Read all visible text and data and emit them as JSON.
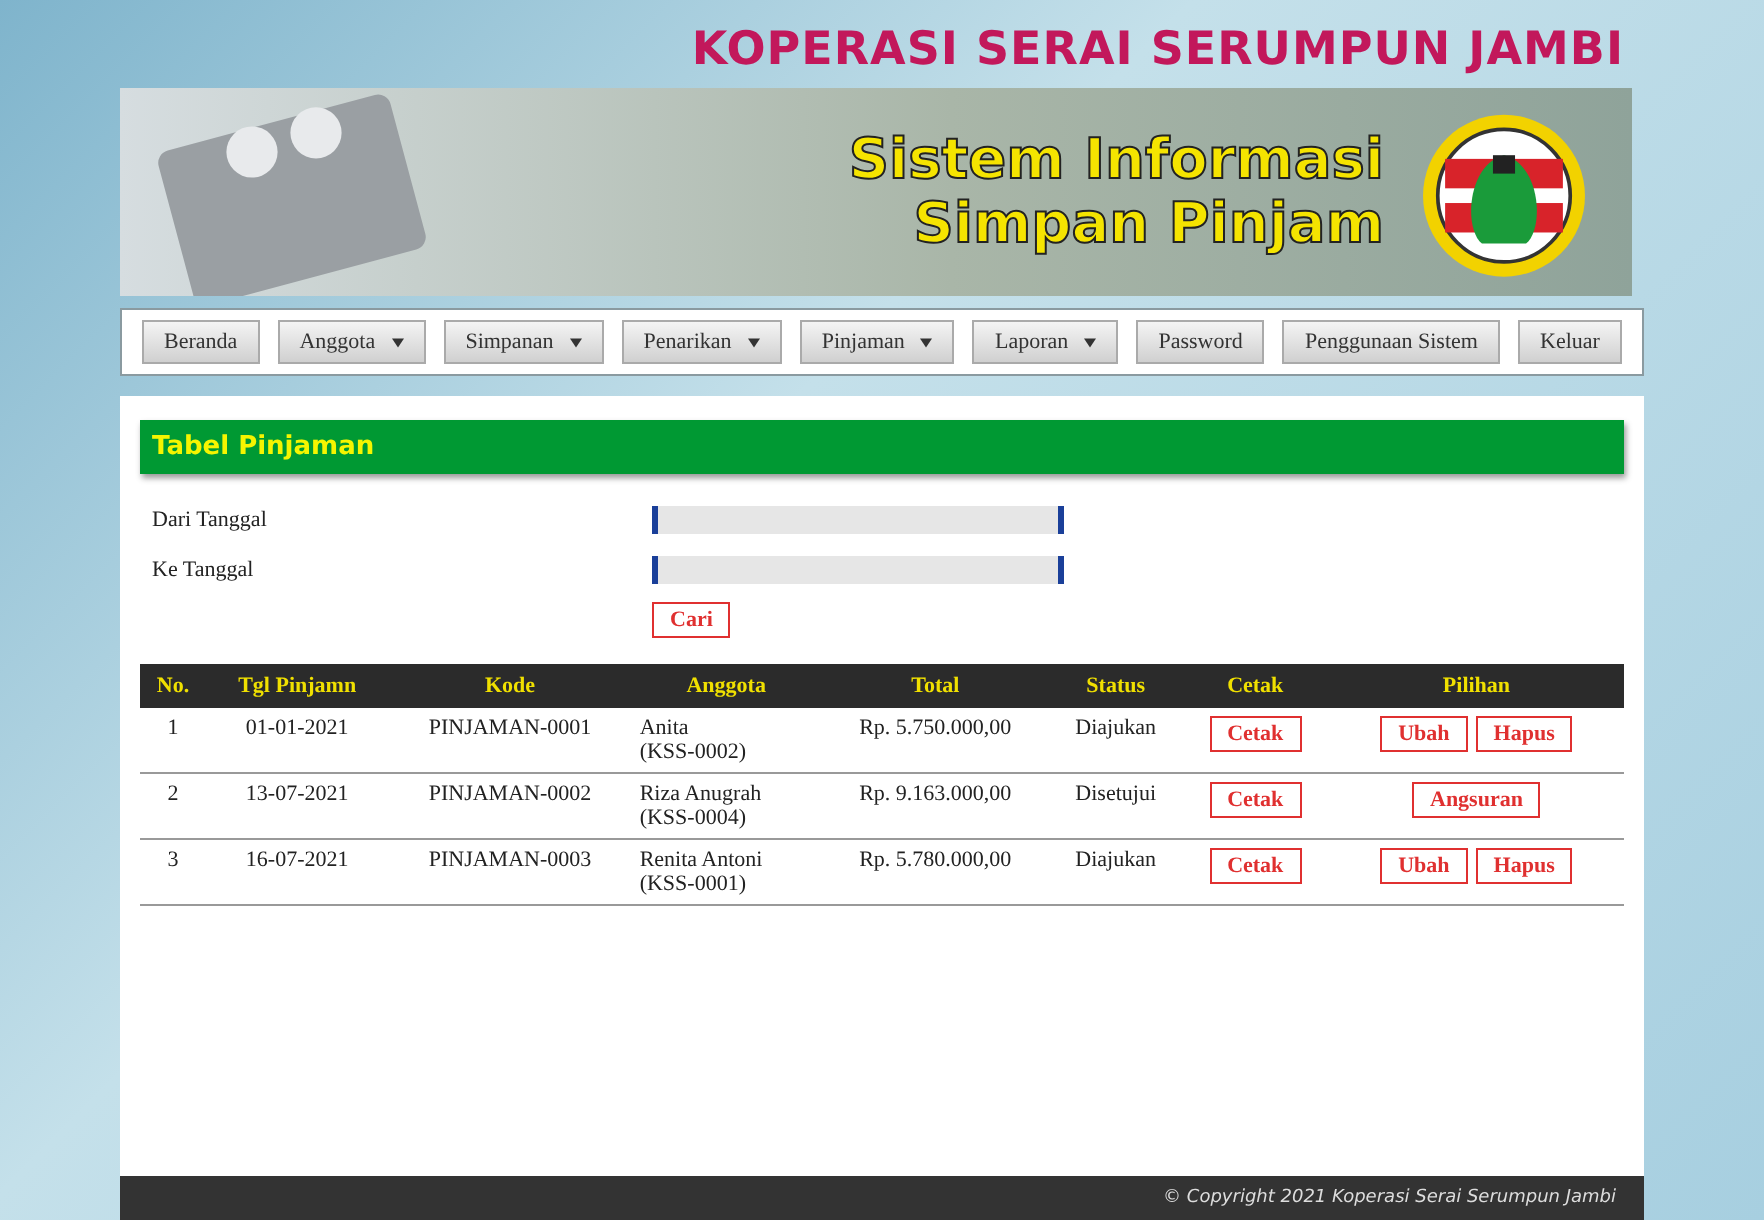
{
  "header": {
    "org_title": "KOPERASI SERAI SERUMPUN JAMBI",
    "app_title_line1": "Sistem Informasi",
    "app_title_line2": "Simpan Pinjam"
  },
  "nav": [
    {
      "label": "Beranda",
      "dropdown": false
    },
    {
      "label": "Anggota",
      "dropdown": true
    },
    {
      "label": "Simpanan",
      "dropdown": true
    },
    {
      "label": "Penarikan",
      "dropdown": true
    },
    {
      "label": "Pinjaman",
      "dropdown": true
    },
    {
      "label": "Laporan",
      "dropdown": true
    },
    {
      "label": "Password",
      "dropdown": false
    },
    {
      "label": "Penggunaan Sistem",
      "dropdown": false
    },
    {
      "label": "Keluar",
      "dropdown": false
    }
  ],
  "panel_title": "Tabel Pinjaman",
  "filters": [
    {
      "label": "Dari Tanggal"
    },
    {
      "label": "Ke Tanggal"
    }
  ],
  "search_button": "Cari",
  "table": {
    "columns": [
      "No.",
      "Tgl Pinjamn",
      "Kode",
      "Anggota",
      "Total",
      "Status",
      "Cetak",
      "Pilihan"
    ],
    "rows": [
      {
        "no": "1",
        "date": "01-01-2021",
        "code": "PINJAMAN-0001",
        "member": "Anita",
        "member_id": "(KSS-0002)",
        "total": "Rp. 5.750.000,00",
        "status": "Diajukan",
        "print": "Cetak",
        "actions": [
          "Ubah",
          "Hapus"
        ]
      },
      {
        "no": "2",
        "date": "13-07-2021",
        "code": "PINJAMAN-0002",
        "member": "Riza Anugrah",
        "member_id": "(KSS-0004)",
        "total": "Rp. 9.163.000,00",
        "status": "Disetujui",
        "print": "Cetak",
        "actions": [
          "Angsuran"
        ]
      },
      {
        "no": "3",
        "date": "16-07-2021",
        "code": "PINJAMAN-0003",
        "member": "Renita Antoni",
        "member_id": "(KSS-0001)",
        "total": "Rp. 5.780.000,00",
        "status": "Diajukan",
        "print": "Cetak",
        "actions": [
          "Ubah",
          "Hapus"
        ]
      }
    ]
  },
  "footer": "© Copyright 2021 Koperasi Serai Serumpun Jambi"
}
